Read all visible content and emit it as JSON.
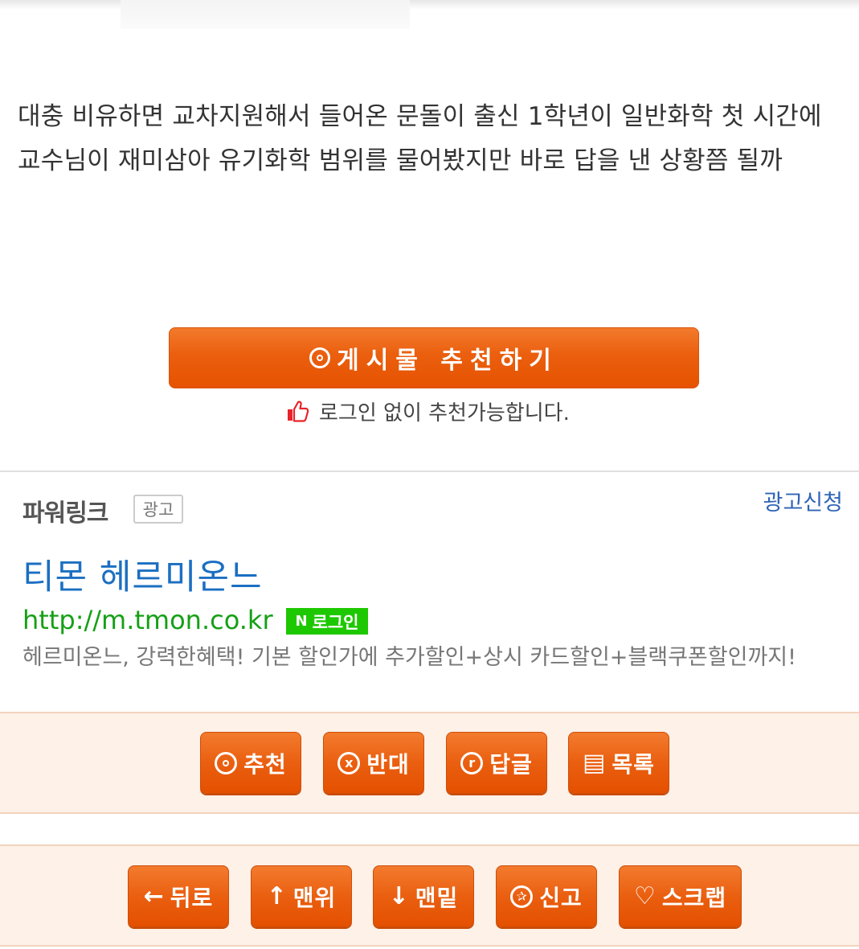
{
  "post": {
    "body": "대충 비유하면 교차지원해서 들어온 문돌이 출신 1학년이 일반화학 첫 시간에 교수님이 재미삼아 유기화학 범위를 물어봤지만 바로 답을 낸 상황쯤 될까"
  },
  "recommend": {
    "button_label": "게시물 추천하기",
    "note": "로그인 없이 추천가능합니다."
  },
  "ad": {
    "section_label": "파워링크",
    "badge": "광고",
    "apply_link": "광고신청",
    "title": "티몬 헤르미온느",
    "url": "http://m.tmon.co.kr",
    "login_badge": "로그인",
    "login_badge_mark": "N",
    "description": "헤르미온느, 강력한혜택! 기본 할인가에 추가할인+상시 카드할인+블랙쿠폰할인까지!"
  },
  "actions": [
    {
      "label": "추천",
      "icon": "recommend-circle-icon"
    },
    {
      "label": "반대",
      "icon": "oppose-x-icon"
    },
    {
      "label": "답글",
      "icon": "reply-r-icon"
    },
    {
      "label": "목록",
      "icon": "list-icon"
    }
  ],
  "nav": [
    {
      "label": "뒤로",
      "icon": "arrow-left-icon"
    },
    {
      "label": "맨위",
      "icon": "arrow-up-icon"
    },
    {
      "label": "맨밑",
      "icon": "arrow-down-icon"
    },
    {
      "label": "신고",
      "icon": "report-icon"
    },
    {
      "label": "스크랩",
      "icon": "heart-icon"
    }
  ],
  "colors": {
    "accent": "#ea5f0e",
    "ad_title": "#1b6fc2",
    "ad_url": "#15a015",
    "naver_green": "#1ec800",
    "band_bg": "#fdf1e8"
  }
}
